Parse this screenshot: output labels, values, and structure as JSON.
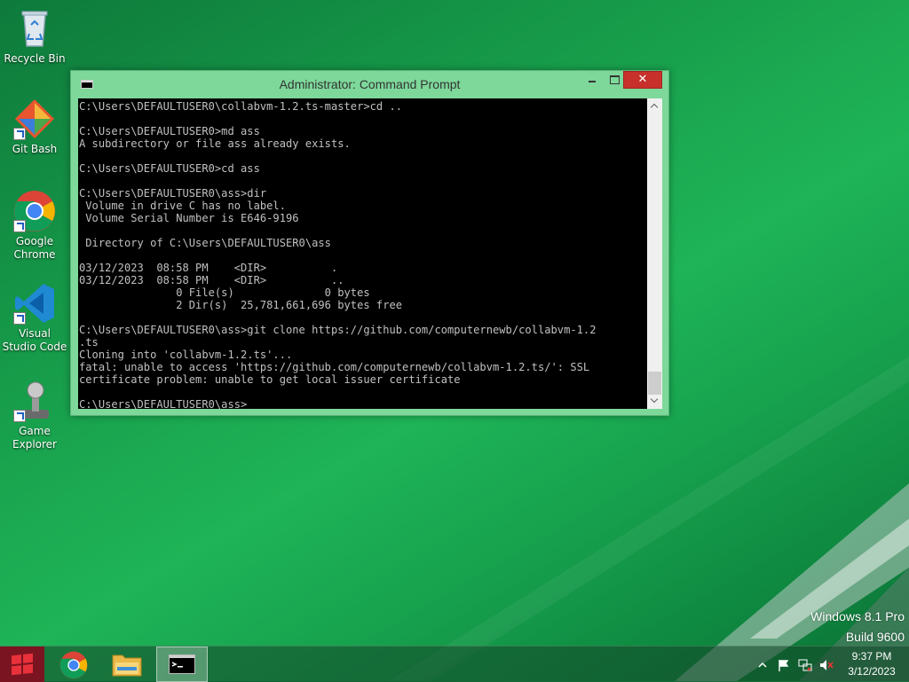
{
  "desktop": {
    "icons": [
      {
        "label": "Recycle Bin"
      },
      {
        "label": "Git Bash"
      },
      {
        "label": "Google Chrome"
      },
      {
        "label": "Visual Studio Code"
      },
      {
        "label": "Game Explorer"
      }
    ]
  },
  "window": {
    "title": "Administrator: Command Prompt",
    "close_label": "✕",
    "console_lines": [
      "C:\\Users\\DEFAULTUSER0\\collabvm-1.2.ts-master>cd ..",
      "",
      "C:\\Users\\DEFAULTUSER0>md ass",
      "A subdirectory or file ass already exists.",
      "",
      "C:\\Users\\DEFAULTUSER0>cd ass",
      "",
      "C:\\Users\\DEFAULTUSER0\\ass>dir",
      " Volume in drive C has no label.",
      " Volume Serial Number is E646-9196",
      "",
      " Directory of C:\\Users\\DEFAULTUSER0\\ass",
      "",
      "03/12/2023  08:58 PM    <DIR>          .",
      "03/12/2023  08:58 PM    <DIR>          ..",
      "               0 File(s)              0 bytes",
      "               2 Dir(s)  25,781,661,696 bytes free",
      "",
      "C:\\Users\\DEFAULTUSER0\\ass>git clone https://github.com/computernewb/collabvm-1.2",
      ".ts",
      "Cloning into 'collabvm-1.2.ts'...",
      "fatal: unable to access 'https://github.com/computernewb/collabvm-1.2.ts/': SSL",
      "certificate problem: unable to get local issuer certificate",
      "",
      "C:\\Users\\DEFAULTUSER0\\ass>"
    ]
  },
  "watermark": {
    "line1": "Windows 8.1 Pro",
    "line2": "Build 9600"
  },
  "taskbar": {
    "clock_time": "9:37 PM",
    "clock_date": "3/12/2023"
  },
  "colors": {
    "close_button": "#c7302b",
    "window_frame": "#7dd89a",
    "start_button": "#7a1420"
  }
}
